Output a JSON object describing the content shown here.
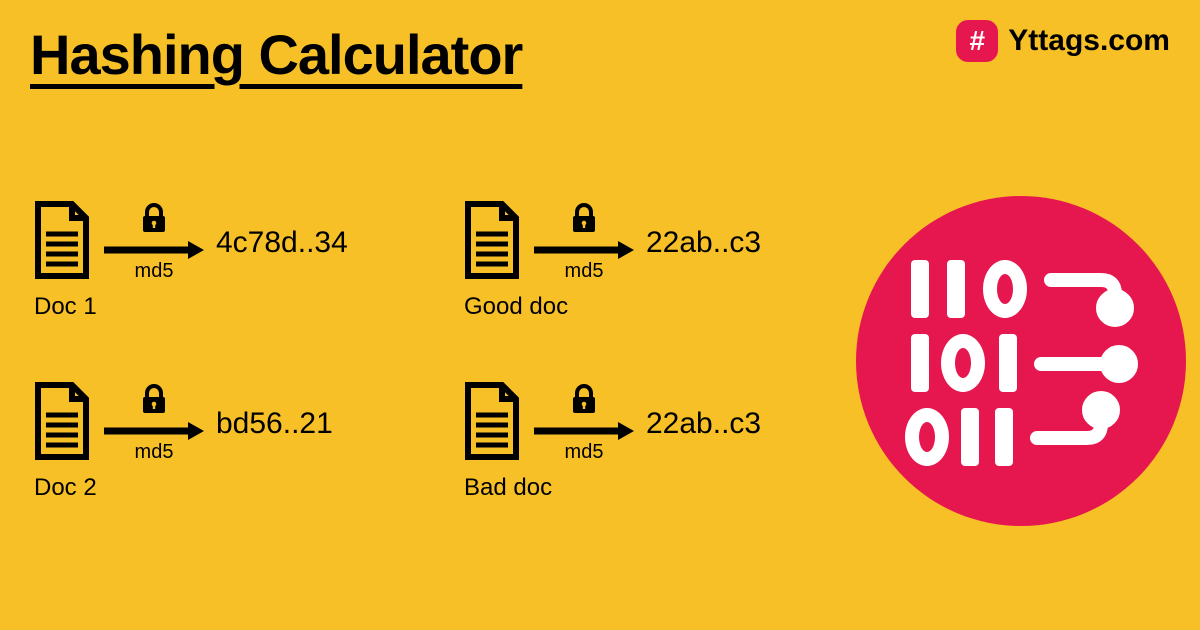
{
  "title": "Hashing Calculator",
  "brand": {
    "name": "Yttags.com",
    "icon_glyph": "#"
  },
  "items": [
    {
      "doc": "Doc 1",
      "algo": "md5",
      "hash": "4c78d..34"
    },
    {
      "doc": "Good doc",
      "algo": "md5",
      "hash": "22ab..c3"
    },
    {
      "doc": "Doc 2",
      "algo": "md5",
      "hash": "bd56..21"
    },
    {
      "doc": "Bad doc",
      "algo": "md5",
      "hash": "22ab..c3"
    }
  ],
  "circle_binary": [
    "110",
    "101",
    "011"
  ]
}
